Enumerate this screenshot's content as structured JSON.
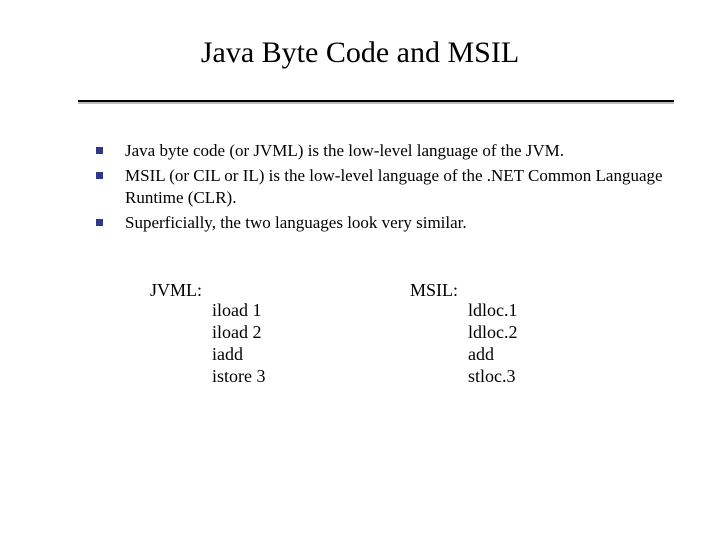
{
  "title": "Java Byte Code and MSIL",
  "bullets": [
    "Java byte code (or JVML) is the low-level language of the JVM.",
    "MSIL (or CIL or IL) is the low-level language of the .NET Common Language Runtime (CLR).",
    "Superficially, the two languages look very similar."
  ],
  "examples": {
    "left": {
      "label": "JVML:",
      "lines": [
        "iload 1",
        "iload 2",
        "iadd",
        "istore 3"
      ]
    },
    "right": {
      "label": "MSIL:",
      "lines": [
        "ldloc.1",
        "ldloc.2",
        "add",
        "stloc.3"
      ]
    }
  }
}
